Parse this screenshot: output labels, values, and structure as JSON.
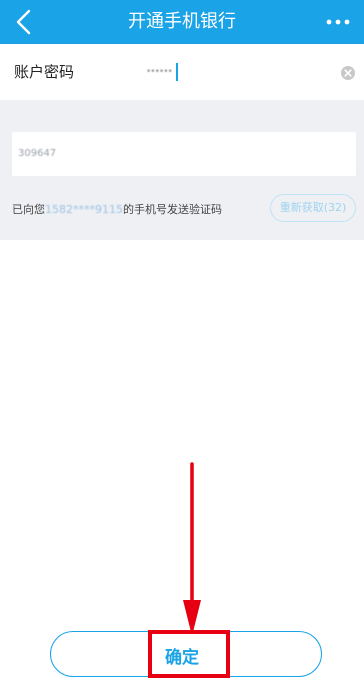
{
  "header": {
    "title": "开通手机银行",
    "back_icon": "chevron-left-icon",
    "more_icon": "more-horizontal-icon",
    "color": "#1aa3e6"
  },
  "password_row": {
    "label": "账户密码",
    "masked_value": "••••••",
    "clear_icon": "clear-circle-icon"
  },
  "verification": {
    "code_value": "309647",
    "sent_prefix": "已向您",
    "phone_masked": "1582****9115",
    "sent_suffix": "的手机号发送验证码",
    "resend_label": "重新获取(32)"
  },
  "confirm": {
    "label": "确定"
  },
  "annotation": {
    "color": "#e60012"
  }
}
